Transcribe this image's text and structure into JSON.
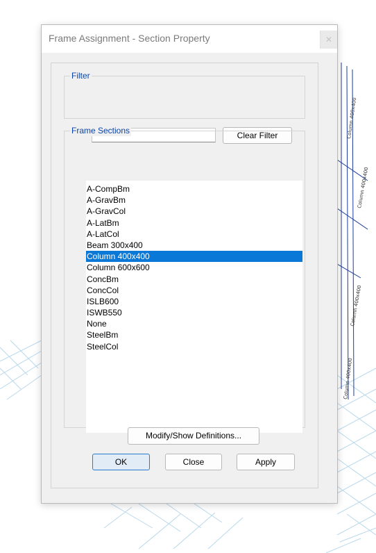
{
  "dialog": {
    "title": "Frame Assignment - Section Property",
    "close_glyph": "✕",
    "filter": {
      "label": "Filter",
      "input_value": "",
      "input_placeholder": "",
      "clear_label": "Clear Filter"
    },
    "sections": {
      "label": "Frame Sections",
      "selected": "Column 400x400",
      "items": [
        {
          "label": "A-CompBm"
        },
        {
          "label": "A-GravBm"
        },
        {
          "label": "A-GravCol"
        },
        {
          "label": "A-LatBm"
        },
        {
          "label": "A-LatCol"
        },
        {
          "label": "Beam 300x400"
        },
        {
          "label": "Column 400x400"
        },
        {
          "label": "Column 600x600"
        },
        {
          "label": "ConcBm"
        },
        {
          "label": "ConcCol"
        },
        {
          "label": "ISLB600"
        },
        {
          "label": "ISWB550"
        },
        {
          "label": "None"
        },
        {
          "label": "SteelBm"
        },
        {
          "label": "SteelCol"
        }
      ]
    },
    "modify_label": "Modify/Show Definitions...",
    "ok_label": "OK",
    "close_label": "Close",
    "apply_label": "Apply"
  },
  "background": {
    "frame_labels": [
      "Column 400x400",
      "Column 400x400",
      "Column 400x400",
      "Column 400x400"
    ]
  },
  "colors": {
    "group_label": "#0a44a8",
    "selection": "#0a78d7",
    "default_button_border": "#2a7acc",
    "grid_lines": "#b8d8ec",
    "frame_lines": "#1a3a9a"
  },
  "icons": {
    "close": "close-icon"
  }
}
